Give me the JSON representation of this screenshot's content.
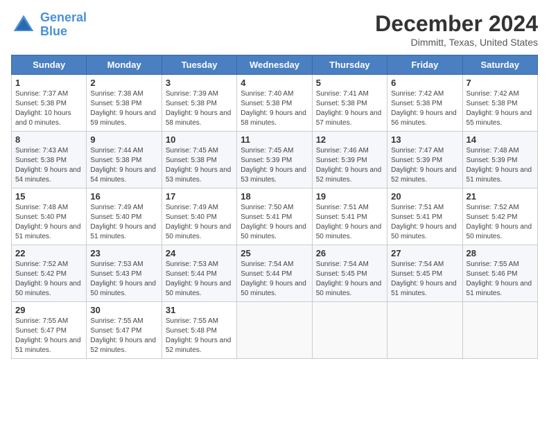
{
  "logo": {
    "line1": "General",
    "line2": "Blue"
  },
  "title": "December 2024",
  "location": "Dimmitt, Texas, United States",
  "days_of_week": [
    "Sunday",
    "Monday",
    "Tuesday",
    "Wednesday",
    "Thursday",
    "Friday",
    "Saturday"
  ],
  "weeks": [
    [
      {
        "day": "1",
        "sunrise": "7:37 AM",
        "sunset": "5:38 PM",
        "daylight": "10 hours and 0 minutes."
      },
      {
        "day": "2",
        "sunrise": "7:38 AM",
        "sunset": "5:38 PM",
        "daylight": "9 hours and 59 minutes."
      },
      {
        "day": "3",
        "sunrise": "7:39 AM",
        "sunset": "5:38 PM",
        "daylight": "9 hours and 58 minutes."
      },
      {
        "day": "4",
        "sunrise": "7:40 AM",
        "sunset": "5:38 PM",
        "daylight": "9 hours and 58 minutes."
      },
      {
        "day": "5",
        "sunrise": "7:41 AM",
        "sunset": "5:38 PM",
        "daylight": "9 hours and 57 minutes."
      },
      {
        "day": "6",
        "sunrise": "7:42 AM",
        "sunset": "5:38 PM",
        "daylight": "9 hours and 56 minutes."
      },
      {
        "day": "7",
        "sunrise": "7:42 AM",
        "sunset": "5:38 PM",
        "daylight": "9 hours and 55 minutes."
      }
    ],
    [
      {
        "day": "8",
        "sunrise": "7:43 AM",
        "sunset": "5:38 PM",
        "daylight": "9 hours and 54 minutes."
      },
      {
        "day": "9",
        "sunrise": "7:44 AM",
        "sunset": "5:38 PM",
        "daylight": "9 hours and 54 minutes."
      },
      {
        "day": "10",
        "sunrise": "7:45 AM",
        "sunset": "5:38 PM",
        "daylight": "9 hours and 53 minutes."
      },
      {
        "day": "11",
        "sunrise": "7:45 AM",
        "sunset": "5:39 PM",
        "daylight": "9 hours and 53 minutes."
      },
      {
        "day": "12",
        "sunrise": "7:46 AM",
        "sunset": "5:39 PM",
        "daylight": "9 hours and 52 minutes."
      },
      {
        "day": "13",
        "sunrise": "7:47 AM",
        "sunset": "5:39 PM",
        "daylight": "9 hours and 52 minutes."
      },
      {
        "day": "14",
        "sunrise": "7:48 AM",
        "sunset": "5:39 PM",
        "daylight": "9 hours and 51 minutes."
      }
    ],
    [
      {
        "day": "15",
        "sunrise": "7:48 AM",
        "sunset": "5:40 PM",
        "daylight": "9 hours and 51 minutes."
      },
      {
        "day": "16",
        "sunrise": "7:49 AM",
        "sunset": "5:40 PM",
        "daylight": "9 hours and 51 minutes."
      },
      {
        "day": "17",
        "sunrise": "7:49 AM",
        "sunset": "5:40 PM",
        "daylight": "9 hours and 50 minutes."
      },
      {
        "day": "18",
        "sunrise": "7:50 AM",
        "sunset": "5:41 PM",
        "daylight": "9 hours and 50 minutes."
      },
      {
        "day": "19",
        "sunrise": "7:51 AM",
        "sunset": "5:41 PM",
        "daylight": "9 hours and 50 minutes."
      },
      {
        "day": "20",
        "sunrise": "7:51 AM",
        "sunset": "5:41 PM",
        "daylight": "9 hours and 50 minutes."
      },
      {
        "day": "21",
        "sunrise": "7:52 AM",
        "sunset": "5:42 PM",
        "daylight": "9 hours and 50 minutes."
      }
    ],
    [
      {
        "day": "22",
        "sunrise": "7:52 AM",
        "sunset": "5:42 PM",
        "daylight": "9 hours and 50 minutes."
      },
      {
        "day": "23",
        "sunrise": "7:53 AM",
        "sunset": "5:43 PM",
        "daylight": "9 hours and 50 minutes."
      },
      {
        "day": "24",
        "sunrise": "7:53 AM",
        "sunset": "5:44 PM",
        "daylight": "9 hours and 50 minutes."
      },
      {
        "day": "25",
        "sunrise": "7:54 AM",
        "sunset": "5:44 PM",
        "daylight": "9 hours and 50 minutes."
      },
      {
        "day": "26",
        "sunrise": "7:54 AM",
        "sunset": "5:45 PM",
        "daylight": "9 hours and 50 minutes."
      },
      {
        "day": "27",
        "sunrise": "7:54 AM",
        "sunset": "5:45 PM",
        "daylight": "9 hours and 51 minutes."
      },
      {
        "day": "28",
        "sunrise": "7:55 AM",
        "sunset": "5:46 PM",
        "daylight": "9 hours and 51 minutes."
      }
    ],
    [
      {
        "day": "29",
        "sunrise": "7:55 AM",
        "sunset": "5:47 PM",
        "daylight": "9 hours and 51 minutes."
      },
      {
        "day": "30",
        "sunrise": "7:55 AM",
        "sunset": "5:47 PM",
        "daylight": "9 hours and 52 minutes."
      },
      {
        "day": "31",
        "sunrise": "7:55 AM",
        "sunset": "5:48 PM",
        "daylight": "9 hours and 52 minutes."
      },
      null,
      null,
      null,
      null
    ]
  ]
}
